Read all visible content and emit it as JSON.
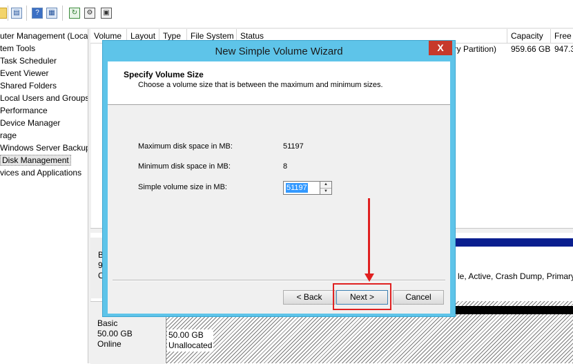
{
  "toolbar": {
    "icons": [
      "folder-icon",
      "view-icon",
      "help-icon",
      "properties-icon",
      "refresh-icon",
      "settings-icon",
      "console-icon"
    ]
  },
  "tree": {
    "items": [
      "uter Management (Local",
      "tem Tools",
      "Task Scheduler",
      "Event Viewer",
      "Shared Folders",
      "Local Users and Groups",
      "Performance",
      "Device Manager",
      "rage",
      "Windows Server Backup",
      "Disk Management",
      "vices and Applications"
    ]
  },
  "list": {
    "columns": [
      "Volume",
      "Layout",
      "Type",
      "File System",
      "Status",
      "Capacity",
      "Free"
    ],
    "row": {
      "status": "ary Partition)",
      "capacity": "959.66 GB",
      "free": "947.3"
    }
  },
  "disks": {
    "disk0": {
      "label_fragments": [
        "B",
        "9",
        "O"
      ],
      "partition_text": "le, Active, Crash Dump, Primary"
    },
    "disk1": {
      "type": "Basic",
      "size": "50.00 GB",
      "status": "Online",
      "partition_size": "50.00 GB",
      "partition_state": "Unallocated"
    }
  },
  "wizard": {
    "title": "New Simple Volume Wizard",
    "close_glyph": "X",
    "header_title": "Specify Volume Size",
    "header_subtitle": "Choose a volume size that is between the maximum and minimum sizes.",
    "max_label": "Maximum disk space in MB:",
    "max_value": "51197",
    "min_label": "Minimum disk space in MB:",
    "min_value": "8",
    "size_label": "Simple volume size in MB:",
    "size_value": "51197",
    "back_label": "< Back",
    "next_label": "Next >",
    "cancel_label": "Cancel"
  },
  "colors": {
    "wizard_frame": "#5ec4e9",
    "annotation": "#e02020",
    "disk_bar_primary": "#0a1f8f"
  }
}
